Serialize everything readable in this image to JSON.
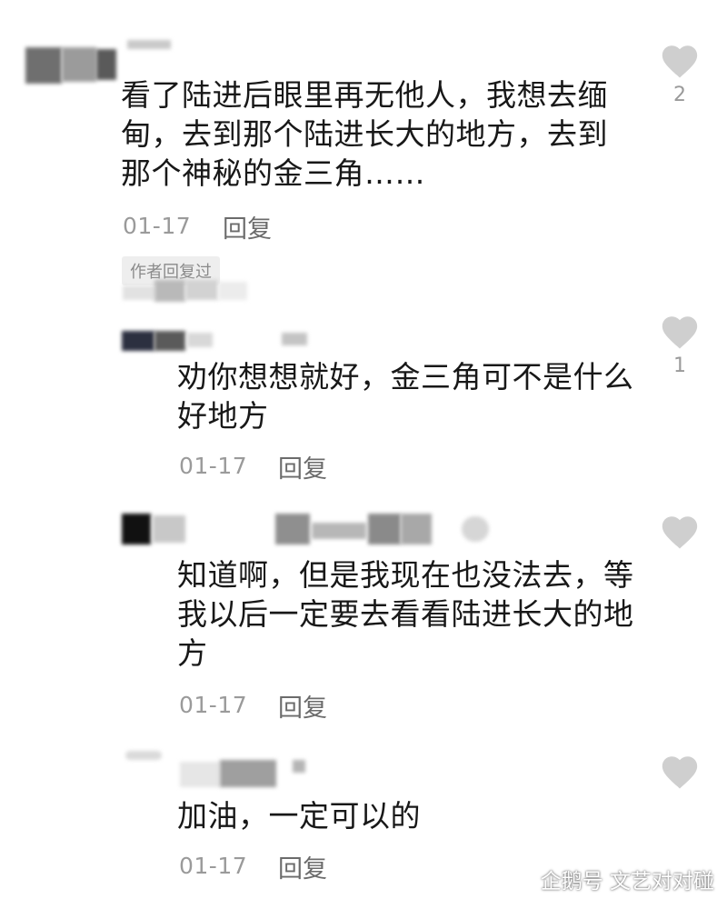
{
  "comments": [
    {
      "text_lines": [
        "看了陆进后眼里再无他人，我想去缅",
        "甸，去到那个陆进长大的地方，去到",
        "那个神秘的金三角……"
      ],
      "date": "01-17",
      "reply_label": "回复",
      "likes": "2",
      "badge": "作者回复过"
    },
    {
      "text_lines": [
        "劝你想想就好，金三角可不是什么",
        "好地方"
      ],
      "date": "01-17",
      "reply_label": "回复",
      "likes": "1"
    },
    {
      "text_lines": [
        "知道啊，但是我现在也没法去，等",
        "我以后一定要去看看陆进长大的地",
        "方"
      ],
      "date": "01-17",
      "reply_label": "回复",
      "likes": ""
    },
    {
      "text_lines": [
        "加油，一定可以的"
      ],
      "date": "01-17",
      "reply_label": "回复",
      "likes": ""
    }
  ],
  "watermark": {
    "text": "企鹅号 文艺对对碰"
  },
  "colors": {
    "heart": "#cfcfcf",
    "date": "#9a9a9a",
    "reply": "#6b6b6b"
  },
  "icons": {
    "like": "heart-icon",
    "watermark": "penguin-icon"
  }
}
